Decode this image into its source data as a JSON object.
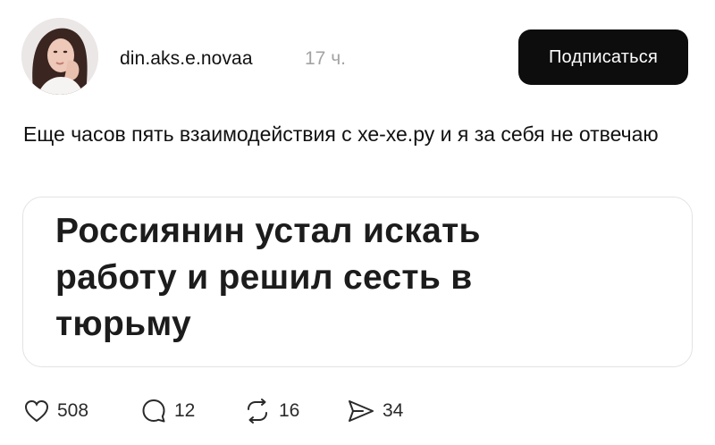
{
  "post": {
    "author": {
      "username": "din.aks.e.novaa",
      "time_ago": "17 ч."
    },
    "subscribe_button": "Подписаться",
    "text": "Еще часов пять взаимодействия с хе-хе.ру и я за себя не отвечаю",
    "quote_headline": "Россиянин устал искать работу и решил сесть в тюрьму",
    "actions": {
      "likes": "508",
      "replies": "12",
      "reposts": "16",
      "shares": "34"
    },
    "icons": [
      "avatar",
      "heart-icon",
      "comment-icon",
      "repost-icon",
      "share-icon"
    ],
    "colors": {
      "button_bg": "#0d0d0d",
      "button_text": "#ffffff",
      "muted_text": "#a3a3a3",
      "card_border": "#e3e3e3"
    }
  }
}
